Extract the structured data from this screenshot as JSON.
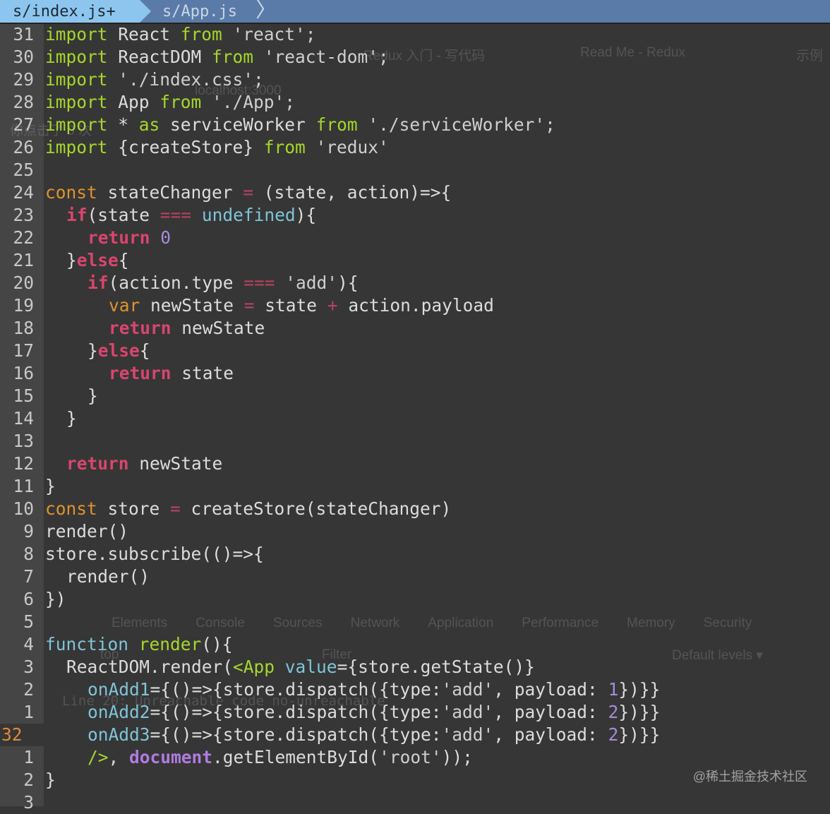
{
  "tabs": {
    "active": "s/index.js+",
    "other": "s/App.js",
    "chevron": "〉"
  },
  "current_line": 32,
  "lines": [
    {
      "num": "31",
      "indent": 0,
      "tokens": [
        [
          "import",
          "g"
        ],
        [
          " React ",
          ""
        ],
        [
          "from",
          "g"
        ],
        [
          " 'react';",
          "s"
        ]
      ]
    },
    {
      "num": "30",
      "indent": 0,
      "tokens": [
        [
          "import",
          "g"
        ],
        [
          " ReactDOM ",
          ""
        ],
        [
          "from",
          "g"
        ],
        [
          " 'react-dom';",
          "s"
        ]
      ]
    },
    {
      "num": "29",
      "indent": 0,
      "tokens": [
        [
          "import",
          "g"
        ],
        [
          " './index.css';",
          "s"
        ]
      ]
    },
    {
      "num": "28",
      "indent": 0,
      "tokens": [
        [
          "import",
          "g"
        ],
        [
          " App ",
          ""
        ],
        [
          "from",
          "g"
        ],
        [
          " './App';",
          "s"
        ]
      ]
    },
    {
      "num": "27",
      "indent": 0,
      "tokens": [
        [
          "import",
          "g"
        ],
        [
          " * ",
          ""
        ],
        [
          "as",
          "g"
        ],
        [
          " serviceWorker ",
          ""
        ],
        [
          "from",
          "g"
        ],
        [
          " './serviceWorker';",
          "s"
        ]
      ]
    },
    {
      "num": "26",
      "indent": 0,
      "tokens": [
        [
          "import",
          "g"
        ],
        [
          " {createStore} ",
          ""
        ],
        [
          "from",
          "g"
        ],
        [
          " 'redux'",
          "s"
        ]
      ]
    },
    {
      "num": "25",
      "indent": 0,
      "tokens": []
    },
    {
      "num": "24",
      "indent": 0,
      "tokens": [
        [
          "const",
          "o"
        ],
        [
          " stateChanger ",
          ""
        ],
        [
          "=",
          "op"
        ],
        [
          " (state, action)=>{",
          ""
        ]
      ]
    },
    {
      "num": "23",
      "indent": 2,
      "tokens": [
        [
          "if",
          "p"
        ],
        [
          "(state ",
          ""
        ],
        [
          "===",
          "op"
        ],
        [
          " ",
          ""
        ],
        [
          "undefined",
          "c"
        ],
        [
          "){",
          ""
        ]
      ]
    },
    {
      "num": "22",
      "indent": 4,
      "tokens": [
        [
          "return",
          "p"
        ],
        [
          " ",
          ""
        ],
        [
          "0",
          "n"
        ]
      ]
    },
    {
      "num": "21",
      "indent": 2,
      "tokens": [
        [
          "}",
          ""
        ],
        [
          "else",
          "p"
        ],
        [
          "{",
          ""
        ]
      ]
    },
    {
      "num": "20",
      "indent": 4,
      "tokens": [
        [
          "if",
          "p"
        ],
        [
          "(action.type ",
          ""
        ],
        [
          "===",
          "op"
        ],
        [
          " 'add'",
          "s"
        ],
        [
          "){",
          ""
        ]
      ]
    },
    {
      "num": "19",
      "indent": 6,
      "tokens": [
        [
          "var",
          "o"
        ],
        [
          " newState ",
          ""
        ],
        [
          "=",
          "op"
        ],
        [
          " state ",
          ""
        ],
        [
          "+",
          "op"
        ],
        [
          " action.payload",
          ""
        ]
      ]
    },
    {
      "num": "18",
      "indent": 6,
      "tokens": [
        [
          "return",
          "p"
        ],
        [
          " newState",
          ""
        ]
      ]
    },
    {
      "num": "17",
      "indent": 4,
      "tokens": [
        [
          "}",
          ""
        ],
        [
          "else",
          "p"
        ],
        [
          "{",
          ""
        ]
      ]
    },
    {
      "num": "16",
      "indent": 6,
      "tokens": [
        [
          "return",
          "p"
        ],
        [
          " state",
          ""
        ]
      ]
    },
    {
      "num": "15",
      "indent": 4,
      "tokens": [
        [
          "}",
          ""
        ]
      ]
    },
    {
      "num": "14",
      "indent": 2,
      "tokens": [
        [
          "}",
          ""
        ]
      ]
    },
    {
      "num": "13",
      "indent": 0,
      "tokens": []
    },
    {
      "num": "12",
      "indent": 2,
      "tokens": [
        [
          "return",
          "p"
        ],
        [
          " newState",
          ""
        ]
      ]
    },
    {
      "num": "11",
      "indent": 0,
      "tokens": [
        [
          "}",
          ""
        ]
      ]
    },
    {
      "num": "10",
      "indent": 0,
      "tokens": [
        [
          "const",
          "o"
        ],
        [
          " store ",
          ""
        ],
        [
          "=",
          "op"
        ],
        [
          " createStore(stateChanger)",
          ""
        ]
      ]
    },
    {
      "num": "9",
      "indent": 0,
      "tokens": [
        [
          "render()",
          ""
        ]
      ]
    },
    {
      "num": "8",
      "indent": 0,
      "tokens": [
        [
          "store.subscribe(()=>{",
          ""
        ]
      ]
    },
    {
      "num": "7",
      "indent": 2,
      "tokens": [
        [
          "render()",
          ""
        ]
      ]
    },
    {
      "num": "6",
      "indent": 0,
      "tokens": [
        [
          "})",
          ""
        ]
      ]
    },
    {
      "num": "5",
      "indent": 0,
      "tokens": []
    },
    {
      "num": "4",
      "indent": 0,
      "tokens": [
        [
          "function",
          "c"
        ],
        [
          " ",
          ""
        ],
        [
          "render",
          "g"
        ],
        [
          "(){",
          ""
        ]
      ]
    },
    {
      "num": "3",
      "indent": 2,
      "tokens": [
        [
          "ReactDOM.render(",
          ""
        ],
        [
          "<App",
          "g"
        ],
        [
          " ",
          ""
        ],
        [
          "value",
          "c"
        ],
        [
          "={store.getState()}",
          ""
        ]
      ]
    },
    {
      "num": "2",
      "indent": 4,
      "tokens": [
        [
          "onAdd1",
          "c"
        ],
        [
          "={()=>{store.dispatch({type:",
          ""
        ],
        [
          "'add'",
          "s"
        ],
        [
          ", payload: ",
          ""
        ],
        [
          "1",
          "n"
        ],
        [
          "})}}",
          ""
        ]
      ]
    },
    {
      "num": "1",
      "indent": 4,
      "tokens": [
        [
          "onAdd2",
          "c"
        ],
        [
          "={()=>{store.dispatch({type:",
          ""
        ],
        [
          "'add'",
          "s"
        ],
        [
          ", payload: ",
          ""
        ],
        [
          "2",
          "n"
        ],
        [
          "})}}",
          ""
        ]
      ]
    },
    {
      "num": "32",
      "indent": 4,
      "tokens": [
        [
          "onAdd3",
          "c"
        ],
        [
          "={()=>{store.dispatch({type:",
          ""
        ],
        [
          "'add'",
          "s"
        ],
        [
          ", payload: ",
          ""
        ],
        [
          "2",
          "n"
        ],
        [
          "})}}",
          ""
        ]
      ]
    },
    {
      "num": "1",
      "indent": 4,
      "tokens": [
        [
          "/>",
          "g"
        ],
        [
          ", ",
          ""
        ],
        [
          "document",
          "d"
        ],
        [
          ".getElementById(",
          ""
        ],
        [
          "'root'",
          "s"
        ],
        [
          "));",
          ""
        ]
      ]
    },
    {
      "num": "2",
      "indent": 0,
      "tokens": [
        [
          "}",
          ""
        ]
      ]
    },
    {
      "num": "3",
      "indent": 0,
      "tokens": []
    }
  ],
  "background_ghost": {
    "browser_tab1": "Redux 入门 - 写代码",
    "browser_tab2": "Read Me - Redux",
    "browser_tab3": "示例",
    "address": "localhost:3000",
    "page_text": "你点击了 0 次",
    "devtools_tabs": [
      "Elements",
      "Console",
      "Sources",
      "Network",
      "Application",
      "Performance",
      "Memory",
      "Security"
    ],
    "console_context": "top",
    "filter": "Filter",
    "levels": "Default levels ▾",
    "warning": "Line 20:  Unreachable code  no-unreachable"
  },
  "watermark": "@稀土掘金技术社区"
}
